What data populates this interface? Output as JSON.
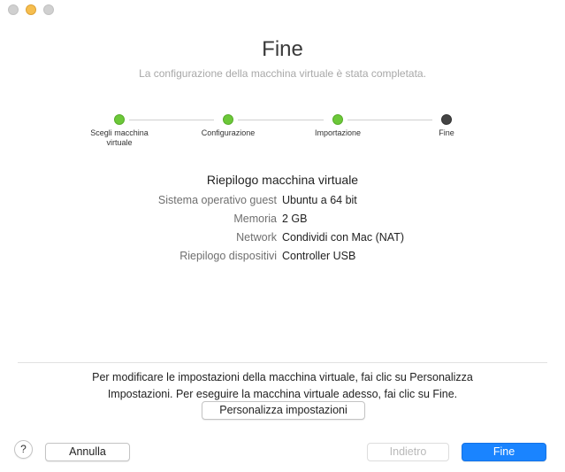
{
  "window": {
    "title": "Fine",
    "subtitle": "La configurazione della macchina virtuale è stata completata."
  },
  "stepper": {
    "steps": [
      {
        "label": "Scegli macchina virtuale",
        "label_line1": "Scegli macchina",
        "label_line2": "virtuale",
        "state": "done"
      },
      {
        "label": "Configurazione",
        "state": "done"
      },
      {
        "label": "Importazione",
        "state": "done"
      },
      {
        "label": "Fine",
        "state": "current"
      }
    ]
  },
  "summary": {
    "title": "Riepilogo macchina virtuale",
    "rows": [
      {
        "key": "Sistema operativo guest",
        "value": "Ubuntu a 64 bit"
      },
      {
        "key": "Memoria",
        "value": "2 GB"
      },
      {
        "key": "Network",
        "value": "Condividi con Mac (NAT)"
      },
      {
        "key": "Riepilogo dispositivi",
        "value": "Controller USB"
      }
    ]
  },
  "info": {
    "line1": "Per modificare le impostazioni della macchina virtuale, fai clic su Personalizza",
    "line2": "Impostazioni. Per eseguire la macchina virtuale adesso, fai clic su Fine."
  },
  "buttons": {
    "customize": "Personalizza impostazioni",
    "help": "?",
    "cancel": "Annulla",
    "back": "Indietro",
    "finish": "Fine"
  },
  "colors": {
    "step_done": "#6cc839",
    "step_current": "#444444",
    "primary_button": "#1a84ff",
    "minimize_light": "#f6be4f"
  },
  "icons": {
    "close": "close-icon",
    "minimize": "minimize-icon",
    "zoom": "zoom-icon",
    "help": "help-icon"
  }
}
